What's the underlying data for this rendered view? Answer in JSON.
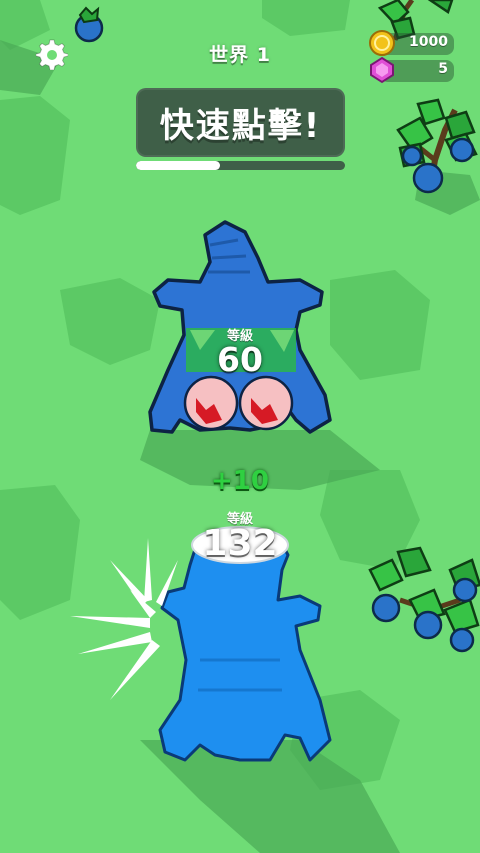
{
  "hud": {
    "world_label": "世界 1",
    "coins": "1000",
    "gems": "5",
    "settings_icon": "gear-icon",
    "coin_icon": "gold-coin-icon",
    "gem_icon": "pink-gem-icon"
  },
  "banner": {
    "text": "快速點擊!"
  },
  "progress": {
    "fraction": 0.4
  },
  "enemy": {
    "level_caption": "等級",
    "level": "60",
    "color": "#2d74d4"
  },
  "player": {
    "level_caption": "等級",
    "level": "132",
    "color": "#1e8ff0"
  },
  "gain_text": "+10",
  "colors": {
    "ground": "#6fdc76",
    "ground_dark": "#5bc866",
    "banner_bg": "#3f5f48",
    "gain": "#2fd041"
  }
}
